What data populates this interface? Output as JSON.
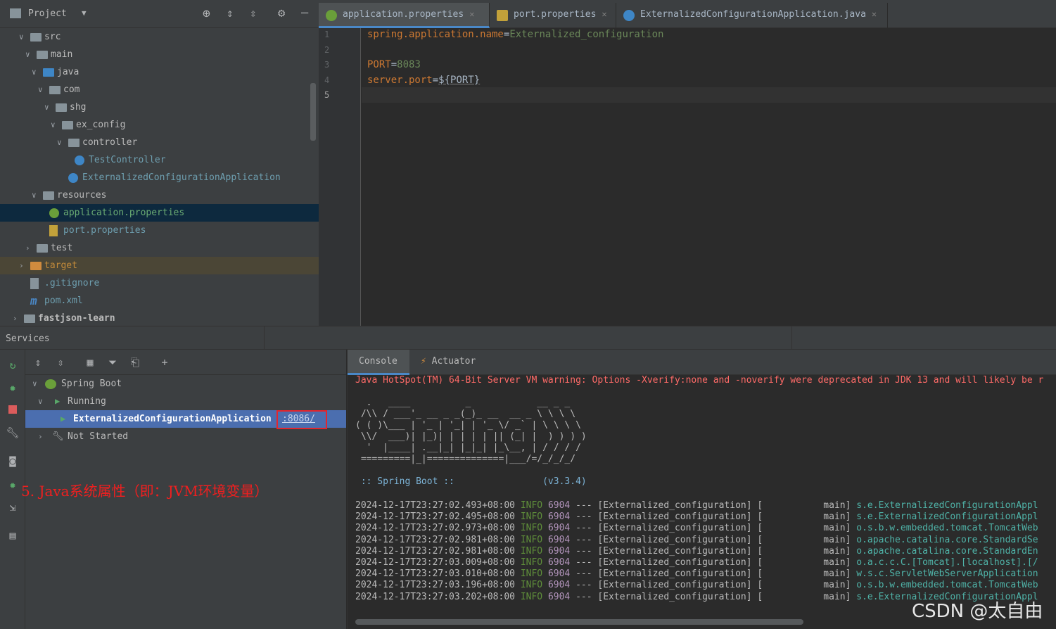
{
  "project": {
    "title": "Project",
    "tree": [
      {
        "label": "src",
        "indent": 0,
        "arrow": "down",
        "icon": "folder-icon"
      },
      {
        "label": "main",
        "indent": 1,
        "arrow": "down",
        "icon": "folder-icon"
      },
      {
        "label": "java",
        "indent": 2,
        "arrow": "down",
        "icon": "source-folder-icon"
      },
      {
        "label": "com",
        "indent": 3,
        "arrow": "down",
        "icon": "package-icon"
      },
      {
        "label": "shg",
        "indent": 4,
        "arrow": "down",
        "icon": "package-icon"
      },
      {
        "label": "ex_config",
        "indent": 5,
        "arrow": "down",
        "icon": "package-icon"
      },
      {
        "label": "controller",
        "indent": 6,
        "arrow": "down",
        "icon": "package-icon"
      },
      {
        "label": "TestController",
        "indent": 7,
        "arrow": "",
        "icon": "class-icon"
      },
      {
        "label": "ExternalizedConfigurationApplication",
        "indent": 6,
        "arrow": "",
        "icon": "spring-boot-class-icon"
      },
      {
        "label": "resources",
        "indent": 2,
        "arrow": "down",
        "icon": "resources-folder-icon"
      },
      {
        "label": "application.properties",
        "indent": 3,
        "arrow": "",
        "icon": "spring-properties-icon"
      },
      {
        "label": "port.properties",
        "indent": 3,
        "arrow": "",
        "icon": "properties-file-icon"
      },
      {
        "label": "test",
        "indent": 1,
        "arrow": "right",
        "icon": "folder-icon"
      },
      {
        "label": "target",
        "indent": 0,
        "arrow": "right",
        "icon": "excluded-folder-icon"
      },
      {
        "label": ".gitignore",
        "indent": 0,
        "arrow": "",
        "icon": "gitignore-file-icon"
      },
      {
        "label": "pom.xml",
        "indent": 0,
        "arrow": "",
        "icon": "maven-icon"
      },
      {
        "label": "fastjson-learn",
        "indent": -1,
        "arrow": "right",
        "icon": "module-folder-icon"
      }
    ]
  },
  "editor": {
    "tabs": [
      {
        "label": "application.properties",
        "active": true
      },
      {
        "label": "port.properties",
        "active": false
      },
      {
        "label": "ExternalizedConfigurationApplication.java",
        "active": false
      }
    ],
    "lines": [
      {
        "num": "1",
        "key": "spring.application.name",
        "sep": "=",
        "value": "Externalized_configuration"
      },
      {
        "num": "2",
        "key": "",
        "sep": "",
        "value": ""
      },
      {
        "num": "3",
        "key": "PORT",
        "sep": "=",
        "value": "8083"
      },
      {
        "num": "4",
        "key": "server.port",
        "sep": "=",
        "value": "${PORT}"
      },
      {
        "num": "5",
        "key": "",
        "sep": "",
        "value": ""
      }
    ]
  },
  "services": {
    "title": "Services",
    "tree": [
      {
        "label": "Spring Boot"
      },
      {
        "label": "Running"
      },
      {
        "label": "ExternalizedConfigurationApplication",
        "port": ":8086/"
      },
      {
        "label": "Not Started"
      }
    ],
    "annotation": "5. Java系统属性（即：JVM环境变量）"
  },
  "console": {
    "tabs": [
      "Console",
      "Actuator"
    ],
    "warning": "Java HotSpot(TM) 64-Bit Server VM warning: Options -Xverify:none and -noverify were deprecated in JDK 13 and will likely be r",
    "banner": [
      "  .   ____          _            __ _ _",
      " /\\\\ / ___'_ __ _ _(_)_ __  __ _ \\ \\ \\ \\",
      "( ( )\\___ | '_ | '_| | '_ \\/ _` | \\ \\ \\ \\",
      " \\\\/  ___)| |_)| | | | | || (_| |  ) ) ) )",
      "  '  |____| .__|_| |_|_| |_\\__, | / / / /",
      " =========|_|==============|___/=/_/_/_/",
      "",
      " :: Spring Boot ::                (v3.3.4)"
    ],
    "logs": [
      {
        "ts": "2024-12-17T23:27:02.493+08:00",
        "level": "INFO",
        "pid": "6904",
        "app": "--- [Externalized_configuration] [           main]",
        "logger": "s.e.ExternalizedConfigurationAppl"
      },
      {
        "ts": "2024-12-17T23:27:02.495+08:00",
        "level": "INFO",
        "pid": "6904",
        "app": "--- [Externalized_configuration] [           main]",
        "logger": "s.e.ExternalizedConfigurationAppl"
      },
      {
        "ts": "2024-12-17T23:27:02.973+08:00",
        "level": "INFO",
        "pid": "6904",
        "app": "--- [Externalized_configuration] [           main]",
        "logger": "o.s.b.w.embedded.tomcat.TomcatWeb"
      },
      {
        "ts": "2024-12-17T23:27:02.981+08:00",
        "level": "INFO",
        "pid": "6904",
        "app": "--- [Externalized_configuration] [           main]",
        "logger": "o.apache.catalina.core.StandardSe"
      },
      {
        "ts": "2024-12-17T23:27:02.981+08:00",
        "level": "INFO",
        "pid": "6904",
        "app": "--- [Externalized_configuration] [           main]",
        "logger": "o.apache.catalina.core.StandardEn"
      },
      {
        "ts": "2024-12-17T23:27:03.009+08:00",
        "level": "INFO",
        "pid": "6904",
        "app": "--- [Externalized_configuration] [           main]",
        "logger": "o.a.c.c.C.[Tomcat].[localhost].[/"
      },
      {
        "ts": "2024-12-17T23:27:03.010+08:00",
        "level": "INFO",
        "pid": "6904",
        "app": "--- [Externalized_configuration] [           main]",
        "logger": "w.s.c.ServletWebServerApplication"
      },
      {
        "ts": "2024-12-17T23:27:03.196+08:00",
        "level": "INFO",
        "pid": "6904",
        "app": "--- [Externalized_configuration] [           main]",
        "logger": "o.s.b.w.embedded.tomcat.TomcatWeb"
      },
      {
        "ts": "2024-12-17T23:27:03.202+08:00",
        "level": "INFO",
        "pid": "6904",
        "app": "--- [Externalized_configuration] [           main]",
        "logger": "s.e.ExternalizedConfigurationAppl"
      }
    ]
  },
  "watermark": "CSDN @太自由",
  "colors": {
    "panel": "#3c3f41",
    "editor": "#2b2b2b",
    "selection": "#4b6eaf",
    "annotation": "#f01f1f",
    "port_box": "#e3262e"
  }
}
